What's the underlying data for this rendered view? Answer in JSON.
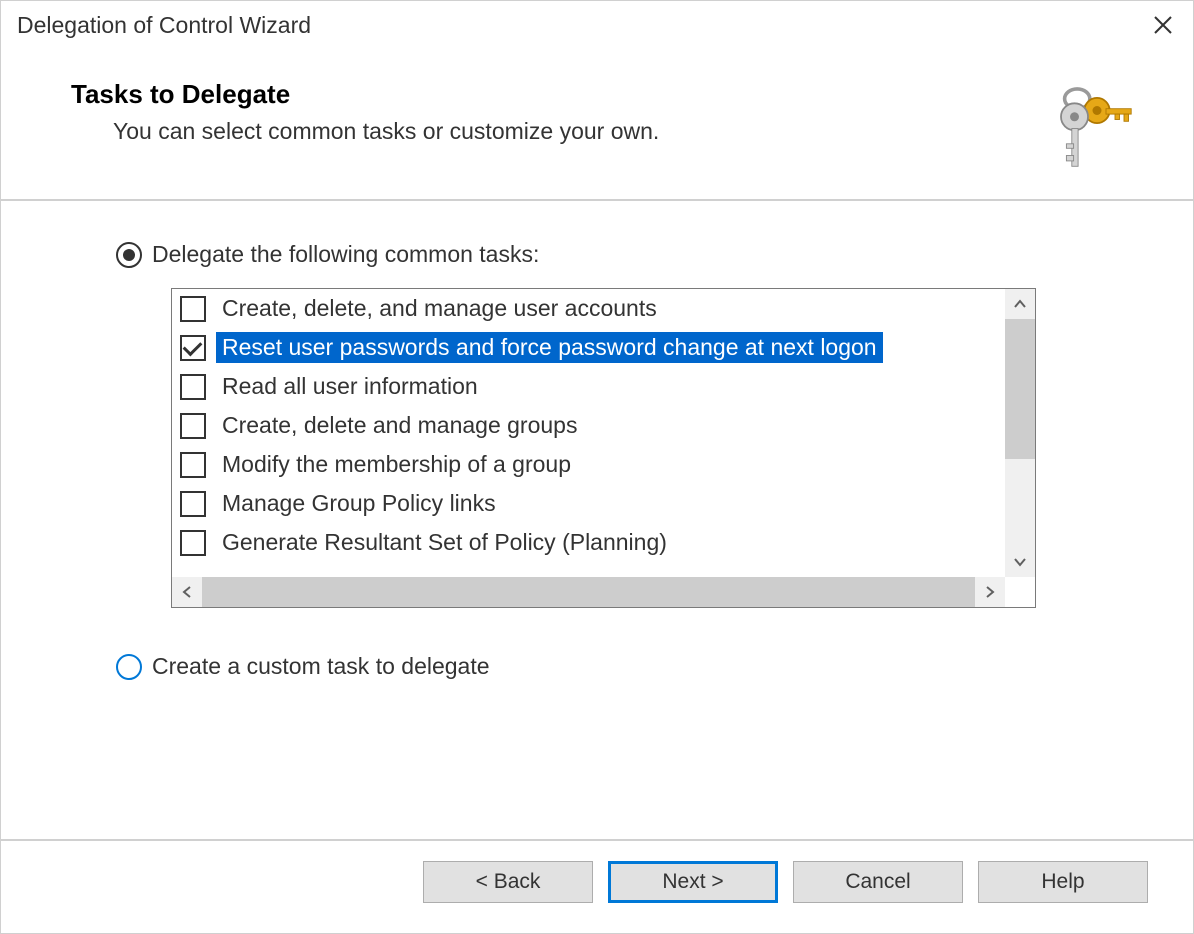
{
  "window": {
    "title": "Delegation of Control Wizard"
  },
  "header": {
    "title": "Tasks to Delegate",
    "subtitle": "You can select common tasks or customize your own."
  },
  "radios": {
    "common": {
      "label": "Delegate the following common tasks:",
      "selected": true
    },
    "custom": {
      "label": "Create a custom task to delegate",
      "selected": false
    }
  },
  "tasks": [
    {
      "label": "Create, delete, and manage user accounts",
      "checked": false,
      "selected": false
    },
    {
      "label": "Reset user passwords and force password change at next logon",
      "checked": true,
      "selected": true
    },
    {
      "label": "Read all user information",
      "checked": false,
      "selected": false
    },
    {
      "label": "Create, delete and manage groups",
      "checked": false,
      "selected": false
    },
    {
      "label": "Modify the membership of a group",
      "checked": false,
      "selected": false
    },
    {
      "label": "Manage Group Policy links",
      "checked": false,
      "selected": false
    },
    {
      "label": "Generate Resultant Set of Policy (Planning)",
      "checked": false,
      "selected": false
    }
  ],
  "buttons": {
    "back": "< Back",
    "next": "Next >",
    "cancel": "Cancel",
    "help": "Help"
  }
}
